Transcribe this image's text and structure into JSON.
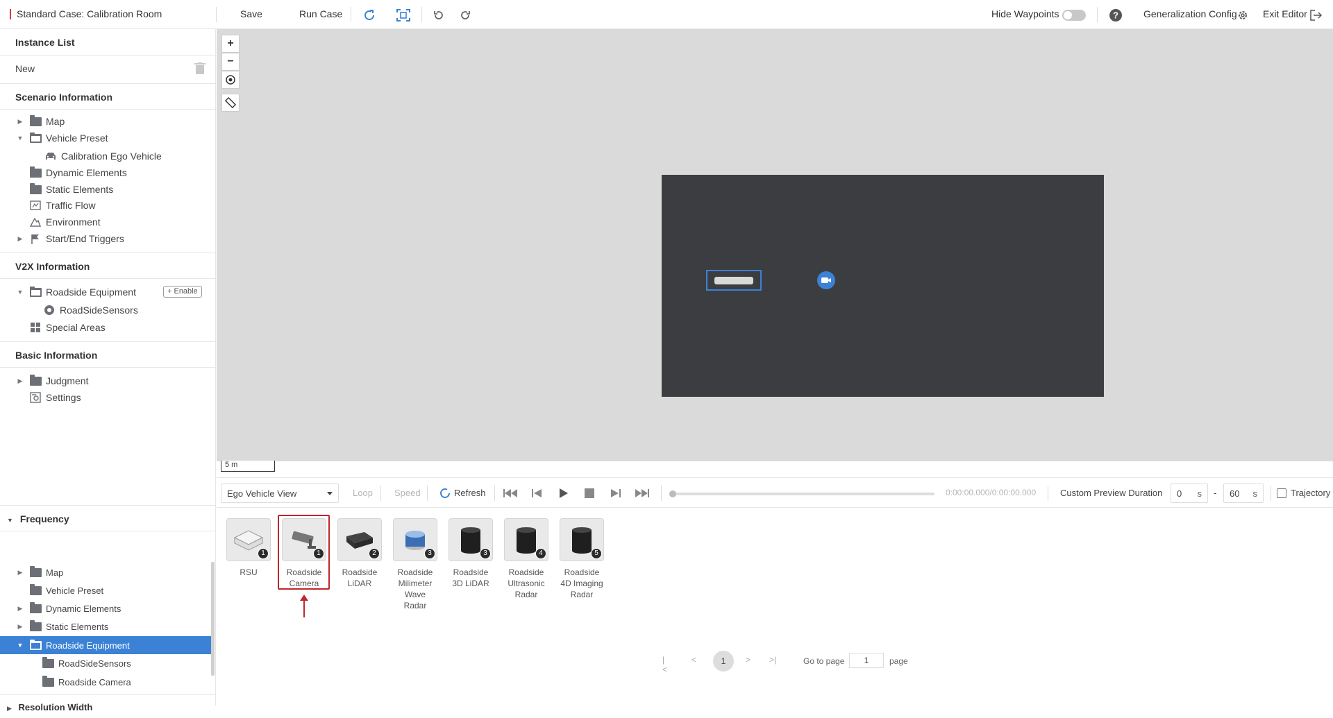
{
  "topbar": {
    "title": "Standard Case: Calibration Room",
    "save": "Save",
    "run_case": "Run Case",
    "hide_waypoints": "Hide Waypoints",
    "generalization_config": "Generalization Config",
    "exit_editor": "Exit Editor"
  },
  "instance_list": {
    "heading": "Instance List",
    "new_item": "New"
  },
  "scenario": {
    "heading": "Scenario Information",
    "items": [
      "Map",
      "Vehicle Preset",
      "Calibration Ego Vehicle",
      "Dynamic Elements",
      "Static Elements",
      "Traffic Flow",
      "Environment",
      "Start/End Triggers"
    ]
  },
  "v2x": {
    "heading": "V2X Information",
    "roadside_equipment": "Roadside Equipment",
    "enable": "+ Enable",
    "road_side_sensors": "RoadSideSensors",
    "special_areas": "Special Areas"
  },
  "basic": {
    "heading": "Basic Information",
    "judgment": "Judgment",
    "settings": "Settings"
  },
  "frequency": {
    "heading": "Frequency",
    "items": [
      "Map",
      "Vehicle Preset",
      "Dynamic Elements",
      "Static Elements",
      "Roadside Equipment",
      "RoadSideSensors",
      "Roadside Camera"
    ],
    "resolution_width": "Resolution Width"
  },
  "map_tools": {
    "zoom_in": "+",
    "zoom_out": "−",
    "scale_label": "5 m"
  },
  "control_bar": {
    "view_select": "Ego Vehicle View",
    "loop": "Loop",
    "speed": "Speed",
    "refresh": "Refresh",
    "time": "0:00:00.000/0:00:00.000",
    "custom_preview": "Custom Preview Duration",
    "start_value": "0",
    "end_value": "60",
    "unit_s": "s",
    "dash": "-",
    "trajectory": "Trajectory"
  },
  "devices": [
    {
      "label": "RSU",
      "badge": "1"
    },
    {
      "label": "Roadside Camera",
      "badge": "1"
    },
    {
      "label": "Roadside LiDAR",
      "badge": "2"
    },
    {
      "label": "Roadside Milimeter Wave Radar",
      "badge": "3"
    },
    {
      "label": "Roadside 3D LiDAR",
      "badge": "3"
    },
    {
      "label": "Roadside Ultrasonic Radar",
      "badge": "4"
    },
    {
      "label": "Roadside 4D Imaging Radar",
      "badge": "5"
    }
  ],
  "pager": {
    "current": "1",
    "goto": "Go to page",
    "input": "1",
    "page": "page"
  },
  "colors": {
    "accent": "#3b82d6",
    "highlight_red": "#c0262d",
    "map_dark": "#3c3d41",
    "canvas_bg": "#dadada"
  }
}
